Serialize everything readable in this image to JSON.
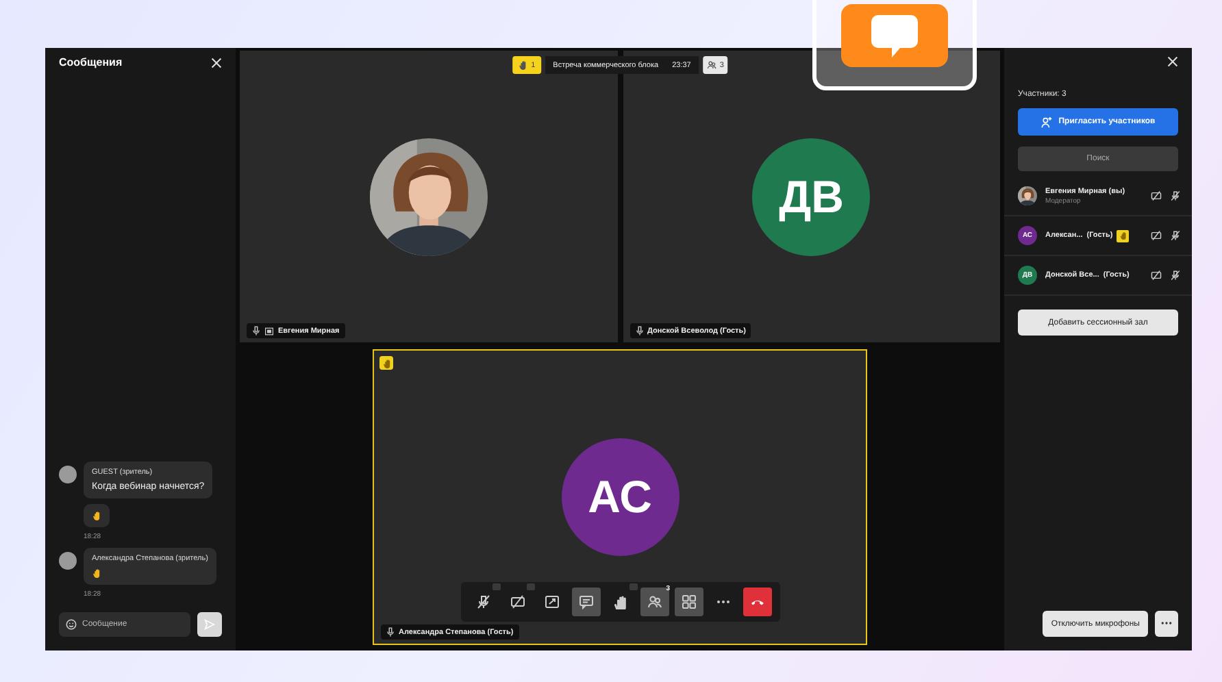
{
  "chat": {
    "title": "Сообщения",
    "messages": [
      {
        "author": "GUEST (зритель)",
        "parts": [
          {
            "kind": "text",
            "text": "Когда вебинар начнется?"
          },
          {
            "kind": "reaction"
          }
        ],
        "time": "18:28"
      },
      {
        "author": "Александра Степанова (зритель)",
        "parts": [
          {
            "kind": "reaction"
          }
        ],
        "time": "18:28"
      }
    ],
    "composer": {
      "placeholder": "Сообщение"
    }
  },
  "meeting": {
    "raised_hands": "1",
    "title": "Встреча коммерческого блока",
    "time": "23:37",
    "participants": "3"
  },
  "tiles": [
    {
      "name": "Евгения Мирная",
      "screen_share": true,
      "speaking": false,
      "hand_raised": false
    },
    {
      "name": "Донской Всеволод (Гость)",
      "avatar": {
        "kind": "initials",
        "initials": "ДВ",
        "color": "#1f7a50"
      },
      "screen_share": false,
      "speaking": false,
      "hand_raised": false
    },
    {
      "name": "Александра Степанова (Гость)",
      "avatar": {
        "kind": "initials",
        "initials": "АС",
        "color": "#6e2a8e"
      },
      "screen_share": false,
      "speaking": true,
      "hand_raised": true
    }
  ],
  "toolbar": [
    {
      "kind": "mic",
      "active": false,
      "menu": true
    },
    {
      "kind": "camera",
      "active": false,
      "menu": true
    },
    {
      "kind": "screen",
      "active": false,
      "menu": false
    },
    {
      "kind": "chat",
      "active": true,
      "menu": false
    },
    {
      "kind": "hand",
      "active": false,
      "menu": true
    },
    {
      "kind": "people",
      "active": true,
      "menu": false,
      "badge": "3"
    },
    {
      "kind": "grid",
      "active": true,
      "menu": false
    },
    {
      "kind": "more",
      "active": false,
      "menu": false
    },
    {
      "kind": "leave",
      "active": false,
      "menu": false
    }
  ],
  "people": {
    "count_label": "Участники: 3",
    "invite_button": "Пригласить участников",
    "search": {
      "placeholder": "Поиск"
    },
    "list": [
      {
        "name": "Евгения Мирная (вы)",
        "role": "Модератор",
        "hand_raised": false
      },
      {
        "name": "Алексан...",
        "tag": "(Гость)",
        "avatar": {
          "kind": "initials",
          "initials": "АС",
          "color": "#6e2a8e"
        },
        "hand_raised": true
      },
      {
        "name": "Донской Все...",
        "tag": "(Гость)",
        "avatar": {
          "kind": "initials",
          "initials": "ДВ",
          "color": "#1f7a50"
        },
        "hand_raised": false
      }
    ],
    "add_room_button": "Добавить сессионный зал",
    "mute_all_button": "Отключить микрофоны"
  }
}
